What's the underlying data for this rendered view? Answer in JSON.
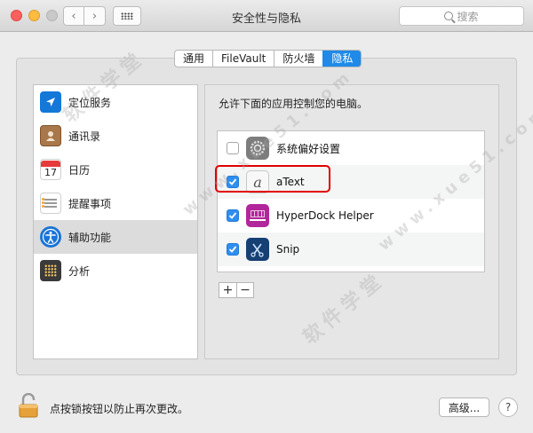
{
  "window": {
    "title": "安全性与隐私",
    "search_placeholder": "搜索",
    "nav_back": "‹",
    "nav_forward": "›"
  },
  "tabs": [
    {
      "label": "通用",
      "active": false
    },
    {
      "label": "FileVault",
      "active": false
    },
    {
      "label": "防火墙",
      "active": false
    },
    {
      "label": "隐私",
      "active": true
    }
  ],
  "sidebar": {
    "items": [
      {
        "label": "定位服务",
        "icon": "location-icon",
        "selected": false
      },
      {
        "label": "通讯录",
        "icon": "contacts-icon",
        "selected": false
      },
      {
        "label": "日历",
        "icon": "calendar-icon",
        "selected": false,
        "icon_text": "17"
      },
      {
        "label": "提醒事项",
        "icon": "reminders-icon",
        "selected": false
      },
      {
        "label": "辅助功能",
        "icon": "accessibility-icon",
        "selected": true
      },
      {
        "label": "分析",
        "icon": "analytics-icon",
        "selected": false
      }
    ]
  },
  "main": {
    "heading": "允许下面的应用控制您的电脑。",
    "apps": [
      {
        "name": "系统偏好设置",
        "checked": false,
        "icon": "system-preferences-icon"
      },
      {
        "name": "aText",
        "checked": true,
        "icon": "atext-icon",
        "icon_text": "a"
      },
      {
        "name": "HyperDock Helper",
        "checked": true,
        "icon": "hyperdock-icon"
      },
      {
        "name": "Snip",
        "checked": true,
        "icon": "snip-icon"
      }
    ],
    "add_label": "+",
    "remove_label": "−"
  },
  "footer": {
    "lock_text": "点按锁按钮以防止再次更改。",
    "advanced_label": "高级...",
    "help_label": "?"
  },
  "watermark": [
    "软件学堂",
    "www.xue51.com"
  ],
  "colors": {
    "accent": "#1f8ae8",
    "highlight": "#e10000",
    "close": "#fc605c",
    "minimize": "#fdbc40"
  }
}
